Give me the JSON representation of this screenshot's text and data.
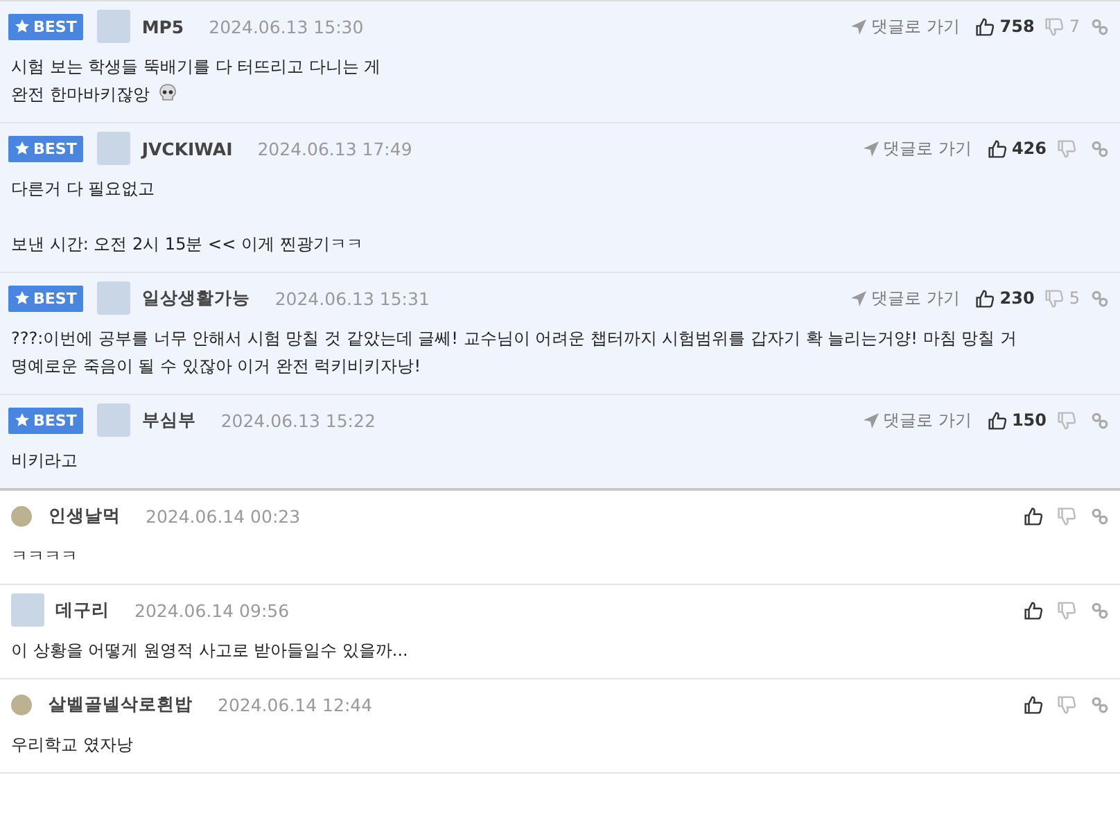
{
  "comments": [
    {
      "best": true,
      "badge": "BEST",
      "avatar_photo": true,
      "name": "MP5",
      "date": "2024.06.13 15:30",
      "goto": "댓글로 가기",
      "likes": "758",
      "dislikes": "7",
      "paragraphs": [
        [
          "시험 보는 학생들 뚝배기를 다 터뜨리고 다니는 게",
          "완전 한마바키잖앙"
        ]
      ],
      "skull": true
    },
    {
      "best": true,
      "badge": "BEST",
      "avatar_photo": true,
      "name": "JVCKIWAI",
      "date": "2024.06.13 17:49",
      "goto": "댓글로 가기",
      "likes": "426",
      "paragraphs": [
        [
          "다른거 다 필요없고"
        ],
        [
          "보낸 시간: 오전 2시 15분 << 이게 찐광기ㅋㅋ"
        ]
      ],
      "skull": false
    },
    {
      "best": true,
      "badge": "BEST",
      "avatar_photo": true,
      "name": "일상생활가능",
      "date": "2024.06.13 15:31",
      "goto": "댓글로 가기",
      "likes": "230",
      "dislikes": "5",
      "paragraphs": [
        [
          "???:이번에 공부를 너무 안해서 시험 망칠 것 같았는데 글쎄! 교수님이 어려운 챕터까지 시험범위를 갑자기 확 늘리는거양! 마침 망칠 거",
          "명예로운 죽음이 될 수 있잖아 이거 완전 럭키비키자낭!"
        ]
      ],
      "skull": false
    },
    {
      "best": true,
      "badge": "BEST",
      "avatar_photo": true,
      "name": "부심부",
      "date": "2024.06.13 15:22",
      "goto": "댓글로 가기",
      "likes": "150",
      "paragraphs": [
        [
          "비키라고"
        ]
      ],
      "skull": false
    },
    {
      "best": false,
      "avatar_photo": false,
      "name": "인생날먹",
      "date": "2024.06.14 00:23",
      "paragraphs": [
        [
          "ㅋㅋㅋㅋ"
        ]
      ],
      "skull": false
    },
    {
      "best": false,
      "avatar_photo": true,
      "name": "데구리",
      "date": "2024.06.14 09:56",
      "paragraphs": [
        [
          "이 상황을 어떻게 원영적 사고로 받아들일수 있을까..."
        ]
      ],
      "skull": false
    },
    {
      "best": false,
      "avatar_photo": false,
      "name": "살벨골넬삭로흰밥",
      "date": "2024.06.14 12:44",
      "paragraphs": [
        [
          "우리학교 였자낭"
        ]
      ],
      "skull": false
    }
  ]
}
